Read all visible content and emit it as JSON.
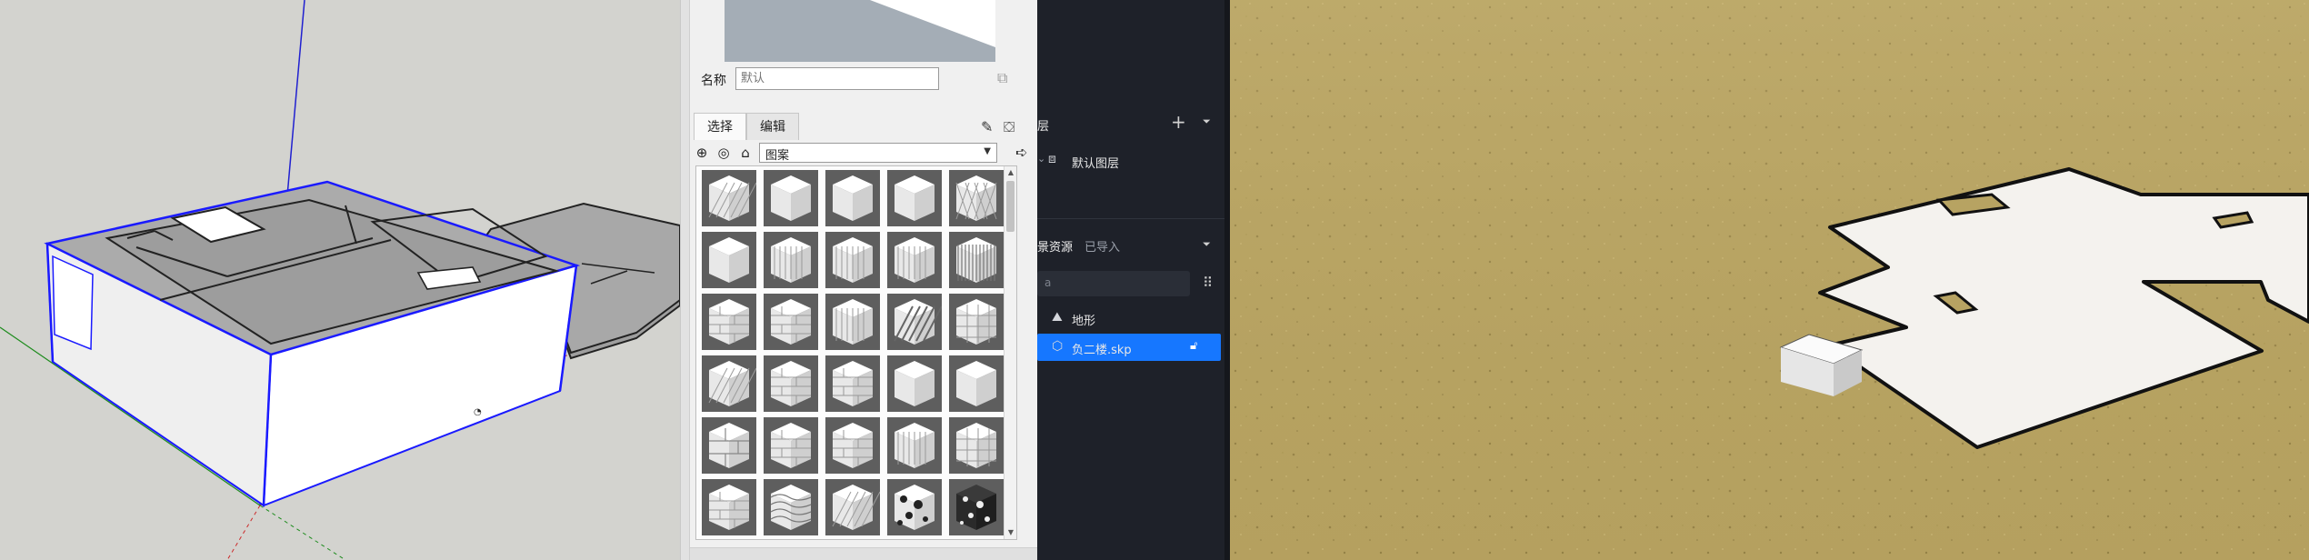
{
  "materials": {
    "name_label": "名称",
    "name_placeholder": "默认",
    "tabs": [
      {
        "label": "选择",
        "active": true
      },
      {
        "label": "编辑",
        "active": false
      }
    ],
    "library_selected": "图案",
    "swatches": [
      {
        "pattern": "diagonal"
      },
      {
        "pattern": "plain"
      },
      {
        "pattern": "plain"
      },
      {
        "pattern": "plain"
      },
      {
        "pattern": "diamond"
      },
      {
        "pattern": "plain"
      },
      {
        "pattern": "vstripe"
      },
      {
        "pattern": "vstripe"
      },
      {
        "pattern": "vstripe"
      },
      {
        "pattern": "vstripe-dense"
      },
      {
        "pattern": "brick"
      },
      {
        "pattern": "brick"
      },
      {
        "pattern": "vstripe"
      },
      {
        "pattern": "dark-diagonal"
      },
      {
        "pattern": "grid"
      },
      {
        "pattern": "diagonal"
      },
      {
        "pattern": "brick"
      },
      {
        "pattern": "brick"
      },
      {
        "pattern": "plain"
      },
      {
        "pattern": "plain"
      },
      {
        "pattern": "brick-large"
      },
      {
        "pattern": "brick"
      },
      {
        "pattern": "brick"
      },
      {
        "pattern": "vstripe"
      },
      {
        "pattern": "grid"
      },
      {
        "pattern": "brick"
      },
      {
        "pattern": "wave"
      },
      {
        "pattern": "diagonal"
      },
      {
        "pattern": "stone"
      },
      {
        "pattern": "dark-stone"
      }
    ]
  },
  "layers": {
    "section_title": "层",
    "items": [
      {
        "name": "默认图层"
      }
    ]
  },
  "assets": {
    "tab_active": "景资源",
    "tab_other": "已导入",
    "search_placeholder": "a",
    "items": [
      {
        "name": "地形",
        "icon": "terrain-icon",
        "selected": false
      },
      {
        "name": "负二楼.skp",
        "icon": "model-icon",
        "selected": true
      }
    ]
  },
  "colors": {
    "accent": "#1677ff",
    "dark_panel": "#1e2129",
    "sketchup_bg": "#d3d3cf",
    "selection_blue": "#1a1aff",
    "ground": "#b5a160"
  }
}
